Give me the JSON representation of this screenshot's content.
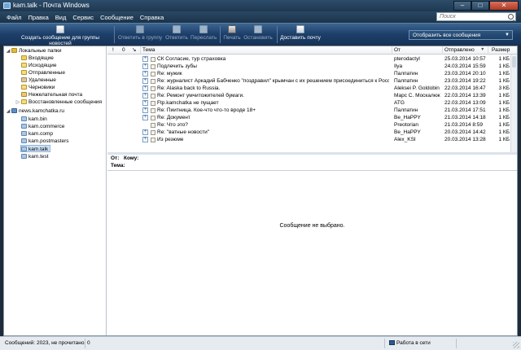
{
  "window": {
    "title": "kam.talk - Почта Windows",
    "controls": [
      "–",
      "□",
      "✕"
    ]
  },
  "menu": {
    "items": [
      "Файл",
      "Правка",
      "Вид",
      "Сервис",
      "Сообщение",
      "Справка"
    ],
    "search_placeholder": "Поиск"
  },
  "toolbar": {
    "new_post": "Создать сообщение для группы новостей",
    "reply_group": "Ответить в группу",
    "reply": "Ответить",
    "forward": "Переслать",
    "print": "Печать",
    "stop": "Остановить",
    "deliver": "Доставить почту",
    "filter": "Отобразить все сообщения"
  },
  "folders": {
    "local_root": "Локальные папки",
    "local": [
      "Входящие",
      "Исходящие",
      "Отправленные",
      "Удаленные",
      "Черновики",
      "Нежелательная почта",
      "Восстановленные сообщения"
    ],
    "news_root": "news.kamchatka.ru",
    "groups": [
      "kam.bin",
      "kam.commerce",
      "kam.comp",
      "kam.postmasters",
      "kam.talk",
      "kam.test"
    ],
    "selected": "kam.talk"
  },
  "list": {
    "columns": {
      "flag": "!",
      "attach": "0",
      "watch": "↘",
      "subject": "Тема",
      "from": "От",
      "date": "Отправлено",
      "size": "Размер"
    },
    "rows": [
      {
        "subject": "СК Согласие, тур страховка",
        "from": "pterodactyl",
        "date": "25.03.2014 10:57",
        "size": "1 КБ"
      },
      {
        "subject": "Подлечить зубы",
        "from": "Ilya",
        "date": "24.03.2014 15:59",
        "size": "1 КБ"
      },
      {
        "subject": "Re: мужик",
        "from": "Палпатин",
        "date": "23.03.2014 20:10",
        "size": "1 КБ"
      },
      {
        "subject": "Re: журналист Аркадий Бабченко \"поздравил\" крымчан с их решением присоединиться к России",
        "from": "Палпатин",
        "date": "23.03.2014 19:22",
        "size": "1 КБ"
      },
      {
        "subject": "Re: Alaska back to Russia.",
        "from": "Aleksei P. Goldobin",
        "date": "22.03.2014 16:47",
        "size": "3 КБ"
      },
      {
        "subject": "Re: Ремонт умчитожителей бумаги.",
        "from": "Марс С. Москалюк",
        "date": "22.03.2014 13:39",
        "size": "1 КБ"
      },
      {
        "subject": "Ftp.kamchatka не пущает",
        "from": "ATG",
        "date": "22.03.2014 13:09",
        "size": "1 КБ"
      },
      {
        "subject": "Re: Пиитница. Кое-что что-то вроде 18+",
        "from": "Палпатин",
        "date": "21.03.2014 17:51",
        "size": "1 КБ"
      },
      {
        "subject": "Re: Документ",
        "from": "Be_HaPPY",
        "date": "21.03.2014 14:18",
        "size": "1 КБ"
      },
      {
        "subject": "Re: Что это?",
        "from": "Preotorian",
        "date": "21.03.2014 8:59",
        "size": "1 КБ"
      },
      {
        "subject": "Re: \"ватные новости\"",
        "from": "Be_HaPPY",
        "date": "20.03.2014 14:42",
        "size": "1 КБ"
      },
      {
        "subject": "Из резюме",
        "from": "Alex_KSI",
        "date": "20.03.2014 13:28",
        "size": "1 КБ"
      }
    ]
  },
  "preview": {
    "from_label": "От:",
    "to_label": "Кому:",
    "subject_label": "Тема:",
    "empty_text": "Сообщение не выбрано."
  },
  "status": {
    "left": "Сообщений: 2023, не прочитано: 0",
    "right": "Работа в сети"
  }
}
